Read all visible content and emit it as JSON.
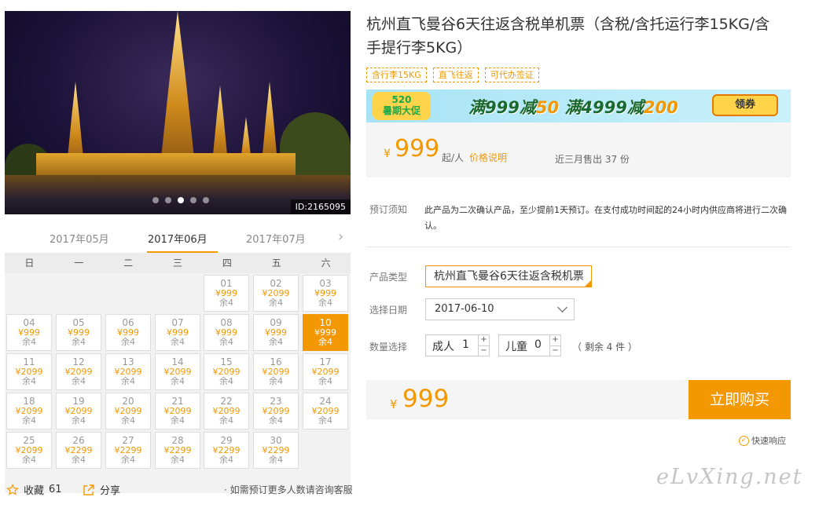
{
  "hero": {
    "image_id": "ID:2165095",
    "slides": 5,
    "active_slide": 2
  },
  "calendar": {
    "months": [
      "2017年05月",
      "2017年06月",
      "2017年07月"
    ],
    "active_month": 1,
    "weekdays": [
      "日",
      "一",
      "二",
      "三",
      "四",
      "五",
      "六"
    ],
    "first_col": 4,
    "selected_day": "10",
    "days": [
      {
        "d": "01",
        "p": "¥999",
        "s": "余4"
      },
      {
        "d": "02",
        "p": "¥2099",
        "s": "余4"
      },
      {
        "d": "03",
        "p": "¥999",
        "s": "余4"
      },
      {
        "d": "04",
        "p": "¥999",
        "s": "余4"
      },
      {
        "d": "05",
        "p": "¥999",
        "s": "余4"
      },
      {
        "d": "06",
        "p": "¥999",
        "s": "余4"
      },
      {
        "d": "07",
        "p": "¥999",
        "s": "余4"
      },
      {
        "d": "08",
        "p": "¥999",
        "s": "余4"
      },
      {
        "d": "09",
        "p": "¥999",
        "s": "余4"
      },
      {
        "d": "10",
        "p": "¥999",
        "s": "余4"
      },
      {
        "d": "11",
        "p": "¥2099",
        "s": "余4"
      },
      {
        "d": "12",
        "p": "¥2099",
        "s": "余4"
      },
      {
        "d": "13",
        "p": "¥2099",
        "s": "余4"
      },
      {
        "d": "14",
        "p": "¥2099",
        "s": "余4"
      },
      {
        "d": "15",
        "p": "¥2099",
        "s": "余4"
      },
      {
        "d": "16",
        "p": "¥2099",
        "s": "余4"
      },
      {
        "d": "17",
        "p": "¥2099",
        "s": "余4"
      },
      {
        "d": "18",
        "p": "¥2099",
        "s": "余4"
      },
      {
        "d": "19",
        "p": "¥2099",
        "s": "余4"
      },
      {
        "d": "20",
        "p": "¥2099",
        "s": "余4"
      },
      {
        "d": "21",
        "p": "¥2099",
        "s": "余4"
      },
      {
        "d": "22",
        "p": "¥2099",
        "s": "余4"
      },
      {
        "d": "23",
        "p": "¥2099",
        "s": "余4"
      },
      {
        "d": "24",
        "p": "¥2099",
        "s": "余4"
      },
      {
        "d": "25",
        "p": "¥2099",
        "s": "余4"
      },
      {
        "d": "26",
        "p": "¥2299",
        "s": "余4"
      },
      {
        "d": "27",
        "p": "¥2299",
        "s": "余4"
      },
      {
        "d": "28",
        "p": "¥2299",
        "s": "余4"
      },
      {
        "d": "29",
        "p": "¥2299",
        "s": "余4"
      },
      {
        "d": "30",
        "p": "¥2299",
        "s": "余4"
      }
    ]
  },
  "footer_left": {
    "favorite_label": "收藏",
    "favorite_count": "61",
    "share_label": "分享",
    "consult": "· 如需预订更多人数请咨询客服"
  },
  "product": {
    "title": "杭州直飞曼谷6天往返含税单机票（含税/含托运行李15KG/含手提行李5KG）",
    "tags": [
      "含行李15KG",
      "直飞往返",
      "可代办签证"
    ]
  },
  "banner": {
    "badge_top": "520",
    "badge_bottom": "暑期大促",
    "offer_prefix": "满999减",
    "offer_a": "50",
    "offer_mid": "满4999减",
    "offer_b": "200",
    "coupon": "领券"
  },
  "price": {
    "currency": "¥",
    "amount": "999",
    "per": "起/人",
    "explain": "价格说明",
    "sold": "近三月售出 37 份"
  },
  "notice": {
    "label": "预订须知",
    "text": "此产品为二次确认产品，至少提前1天预订。在支付成功时间起的24小时内供应商将进行二次确认。"
  },
  "form": {
    "type_label": "产品类型",
    "type_value": "杭州直飞曼谷6天往返含税机票",
    "date_label": "选择日期",
    "date_value": "2017-06-10",
    "qty_label": "数量选择",
    "adult_label": "成人",
    "adult_value": "1",
    "child_label": "儿童",
    "child_value": "0",
    "remaining": "（ 剩余 4 件 ）"
  },
  "total": {
    "currency": "¥",
    "amount": "999",
    "buy_label": "立即购买",
    "quick_label": "快速响应"
  },
  "watermark": "eLvXing.net",
  "colors": {
    "accent": "#f39800"
  }
}
